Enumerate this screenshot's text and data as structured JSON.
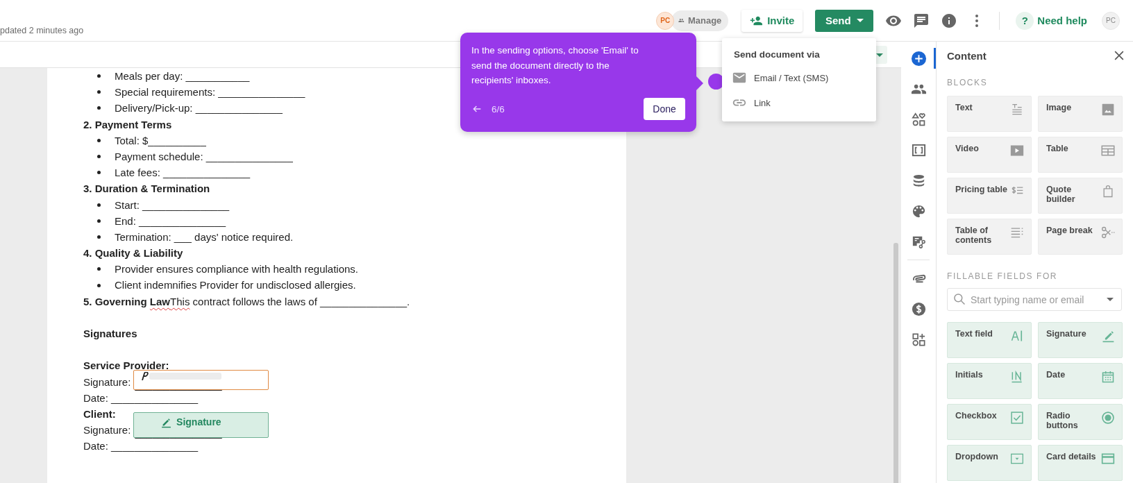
{
  "header": {
    "updated": "pdated 2 minutes ago",
    "collaborator_avatar": "PC",
    "manage_button": "Manage",
    "invite_button": "Invite",
    "send_button": "Send",
    "help_icon": "?",
    "help_button": "Need help",
    "user_avatar": "PC"
  },
  "tour_tooltip": {
    "text": "In the sending options, choose 'Email' to send the document directly to the recipients' inboxes.",
    "step": "6/6",
    "done_button": "Done"
  },
  "send_menu": {
    "title": "Send document via",
    "items": [
      {
        "label": "Email / Text (SMS)",
        "kind": "email"
      },
      {
        "label": "Link",
        "kind": "link"
      }
    ]
  },
  "document": {
    "lines": [
      {
        "kind": "bullet",
        "text": "Meals per day: ___________"
      },
      {
        "kind": "bullet",
        "text": "Special requirements: _______________"
      },
      {
        "kind": "bullet",
        "text": "Delivery/Pick-up: _______________"
      },
      {
        "kind": "heading",
        "text": "2. Payment Terms"
      },
      {
        "kind": "bullet",
        "text": "Total: $__________"
      },
      {
        "kind": "bullet",
        "text": "Payment schedule: _______________"
      },
      {
        "kind": "bullet",
        "text": "Late fees: _______________"
      },
      {
        "kind": "heading",
        "text": "3. Duration & Termination"
      },
      {
        "kind": "bullet",
        "text": "Start: _______________"
      },
      {
        "kind": "bullet",
        "text": "End: _______________"
      },
      {
        "kind": "bullet",
        "text": "Termination: ___ days' notice required."
      },
      {
        "kind": "heading",
        "text": "4. Quality & Liability"
      },
      {
        "kind": "bullet",
        "text": "Provider ensures compliance with health regulations."
      },
      {
        "kind": "bullet",
        "text": "Client indemnifies Provider for undisclosed allergies."
      },
      {
        "kind": "paragraph",
        "parts": [
          {
            "text": "5. Governing ",
            "bold": true,
            "misspelled": false
          },
          {
            "text": "Law",
            "bold": true,
            "misspelled": true
          },
          {
            "text": "This",
            "bold": false,
            "misspelled": true
          },
          {
            "text": " contract follows the laws of _______________.",
            "bold": false,
            "misspelled": false
          }
        ]
      },
      {
        "kind": "section",
        "text": "Signatures"
      },
      {
        "kind": "signer",
        "text": "Service Provider:"
      },
      {
        "kind": "field",
        "label": "Signature:",
        "blank": "_______________",
        "box": {
          "kind": "signed"
        }
      },
      {
        "kind": "field",
        "text": "Date: _______________"
      },
      {
        "kind": "signer",
        "text": "Client:"
      },
      {
        "kind": "field",
        "label": "Signature:",
        "blank": "_______________",
        "box": {
          "kind": "placeholder",
          "label": "Signature"
        }
      },
      {
        "kind": "field",
        "text": "Date: _______________"
      }
    ]
  },
  "rail_items": [
    {
      "kind": "add",
      "selected": true
    },
    {
      "kind": "people",
      "selected": false
    },
    {
      "kind": "shapes",
      "selected": false
    },
    {
      "kind": "frame",
      "selected": false
    },
    {
      "kind": "database",
      "selected": false
    },
    {
      "kind": "palette",
      "selected": false
    },
    {
      "kind": "workflow",
      "selected": false
    },
    {
      "kind": "attachment",
      "selected": false
    },
    {
      "kind": "payment",
      "selected": false
    },
    {
      "kind": "widgets",
      "selected": false
    }
  ],
  "content_panel": {
    "title": "Content",
    "blocks_heading": "BLOCKS",
    "blocks": [
      {
        "label": "Text",
        "kind": "text"
      },
      {
        "label": "Image",
        "kind": "image"
      },
      {
        "label": "Video",
        "kind": "video"
      },
      {
        "label": "Table",
        "kind": "table"
      },
      {
        "label": "Pricing table",
        "kind": "pricing"
      },
      {
        "label": "Quote builder",
        "kind": "quote"
      },
      {
        "label": "Table of contents",
        "kind": "toc"
      },
      {
        "label": "Page break",
        "kind": "pagebreak"
      }
    ],
    "fields_heading": "FILLABLE FIELDS FOR",
    "recipient_search": {
      "placeholder": "Start typing name or email"
    },
    "fields": [
      {
        "label": "Text field",
        "kind": "textfield"
      },
      {
        "label": "Signature",
        "kind": "signature"
      },
      {
        "label": "Initials",
        "kind": "initials"
      },
      {
        "label": "Date",
        "kind": "date"
      },
      {
        "label": "Checkbox",
        "kind": "checkbox"
      },
      {
        "label": "Radio buttons",
        "kind": "radio"
      },
      {
        "label": "Dropdown",
        "kind": "dropdown"
      },
      {
        "label": "Card details",
        "kind": "card"
      }
    ]
  }
}
